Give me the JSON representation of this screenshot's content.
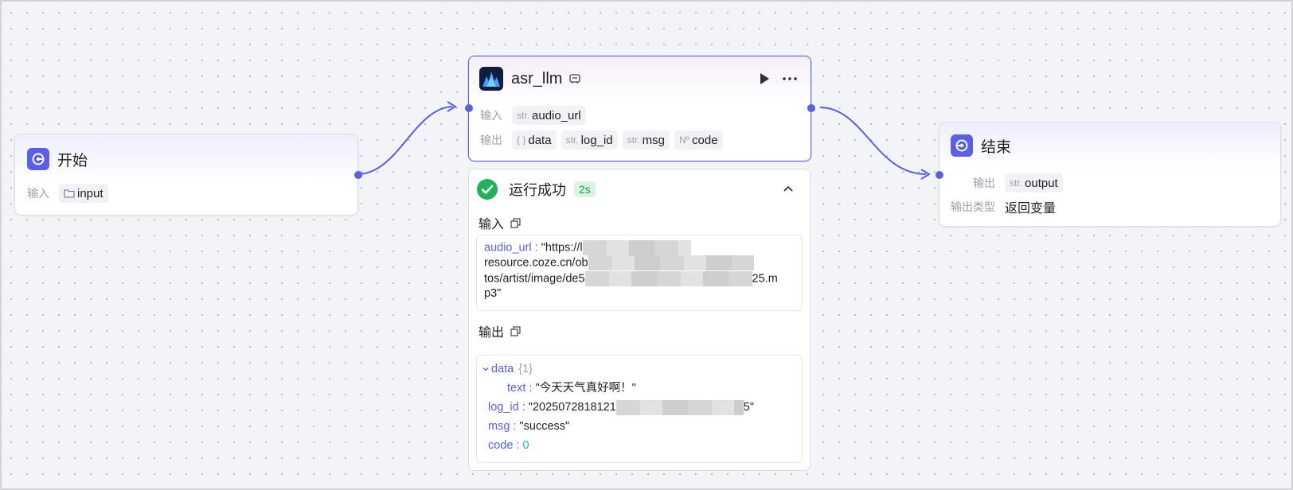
{
  "start_node": {
    "title": "开始",
    "input_label": "输入",
    "input_chip": "input",
    "icon": "start-icon"
  },
  "llm_node": {
    "title": "asr_llm",
    "input_label": "输入",
    "output_label": "输出",
    "inputs": [
      {
        "type": "str.",
        "name": "audio_url"
      }
    ],
    "outputs": [
      {
        "type": "{ }",
        "name": "data"
      },
      {
        "type": "str.",
        "name": "log_id"
      },
      {
        "type": "str.",
        "name": "msg"
      },
      {
        "type": "Nº",
        "name": "code"
      }
    ],
    "icon": "asr-llm-icon"
  },
  "end_node": {
    "title": "结束",
    "output_label": "输出",
    "output_chip_type": "str.",
    "output_chip": "output",
    "output_type_label": "输出类型",
    "output_type_value": "返回变量",
    "icon": "end-icon"
  },
  "run_panel": {
    "status": "运行成功",
    "duration": "2s",
    "input_title": "输入",
    "output_title": "输出",
    "input_json": {
      "key": "audio_url :",
      "line1": "\"https://l",
      "line2": "resource.coze.cn/ob",
      "line3": "tos/artist/image/de5",
      "line3_end": "25.m",
      "line4": "p3\""
    },
    "output_json": {
      "data_key": "data",
      "data_count": "{1}",
      "text_key": "text :",
      "text_val": "\"今天天气真好啊！\"",
      "log_key": "log_id :",
      "log_val_start": "\"2025072818121",
      "log_val_end": "5\"",
      "msg_key": "msg :",
      "msg_val": "\"success\"",
      "code_key": "code :",
      "code_val": "0"
    }
  },
  "colors": {
    "accent": "#5b5fe0",
    "success": "#20b15a",
    "success_bg": "#d9f5e3"
  }
}
